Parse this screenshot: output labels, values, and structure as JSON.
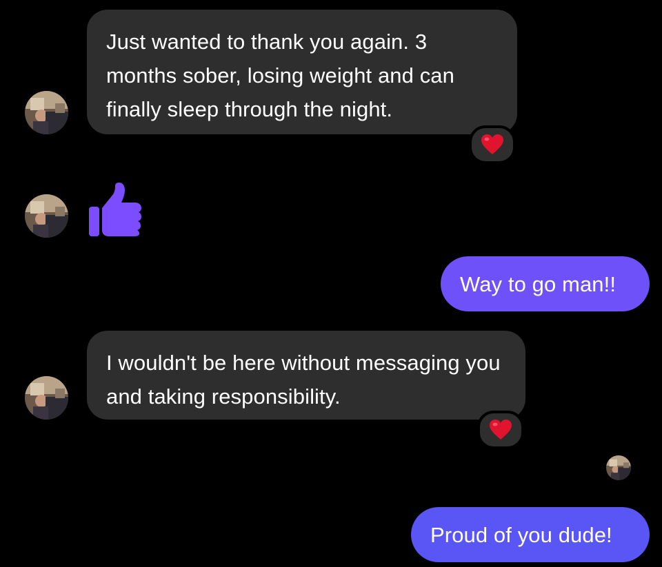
{
  "conversation": {
    "messages": [
      {
        "direction": "incoming",
        "text": "Just wanted to thank you again. 3 months sober, losing weight and can finally sleep through the night.",
        "reaction": "heart"
      },
      {
        "direction": "incoming",
        "sticker": "thumbs-up",
        "sticker_color": "#7b4dff"
      },
      {
        "direction": "outgoing",
        "text": "Way to go man!!"
      },
      {
        "direction": "incoming",
        "text": "I wouldn't be here without messaging you and taking responsibility.",
        "reaction": "heart"
      },
      {
        "direction": "outgoing",
        "text": "Proud of you dude!"
      }
    ]
  },
  "theme": {
    "background": "#000000",
    "incoming_bubble": "#2e2e2e",
    "outgoing_gradient_top": "#7550fa",
    "outgoing_gradient_bottom": "#5b56f5",
    "heart": "#e0142f"
  }
}
